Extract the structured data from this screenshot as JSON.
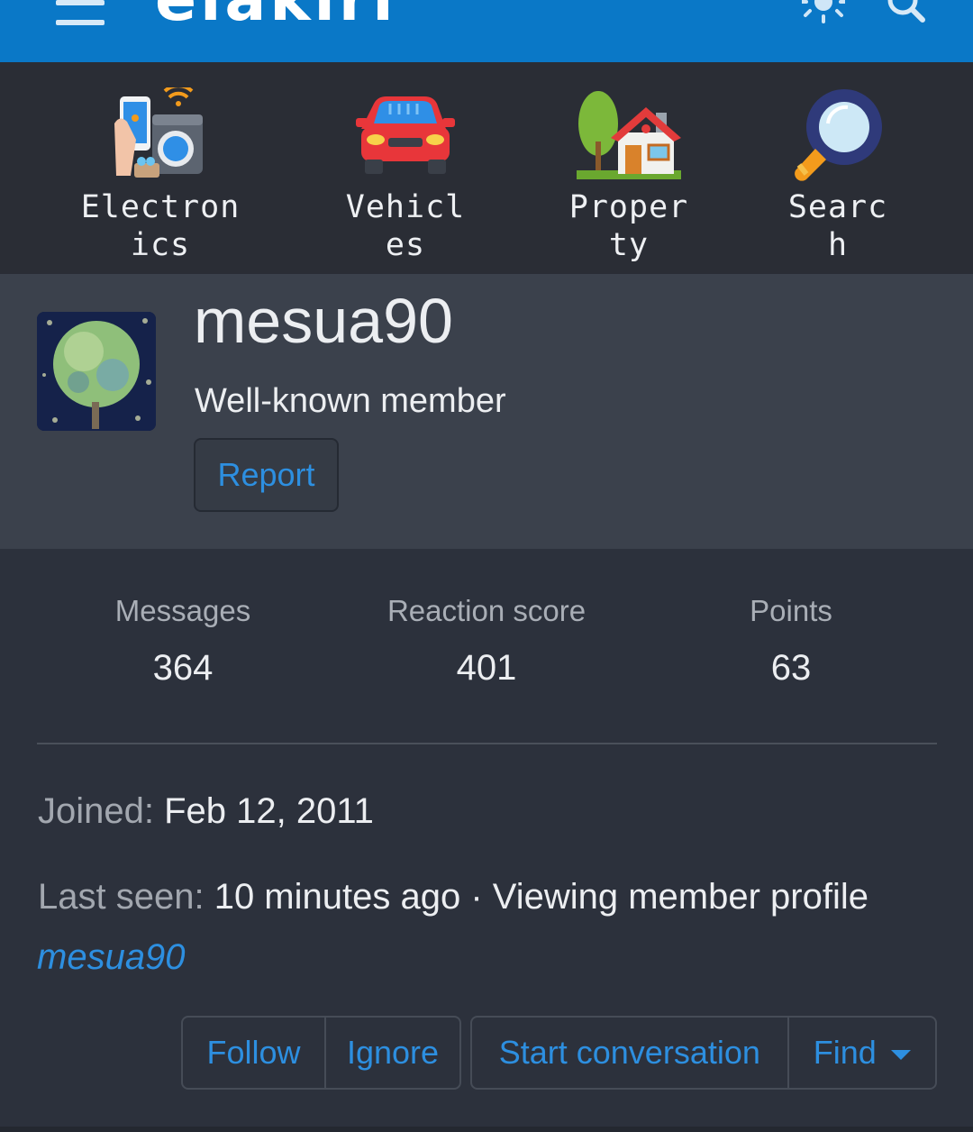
{
  "header": {
    "logo_text": "elakiri",
    "menu_icon": "hamburger-menu-icon",
    "theme_icon": "sun-icon",
    "search_icon": "search-icon",
    "brand_color": "#0a78c7"
  },
  "categories": [
    {
      "label": "Electron\nics",
      "icon": "electronics-icon"
    },
    {
      "label": "Vehicl\nes",
      "icon": "car-icon"
    },
    {
      "label": "Proper\nty",
      "icon": "house-icon"
    },
    {
      "label": "Searc\nh",
      "icon": "magnifier-icon"
    }
  ],
  "profile": {
    "username": "mesua90",
    "user_title": "Well-known member",
    "report_label": "Report",
    "avatar_icon": "tree-globe-avatar"
  },
  "stats": [
    {
      "label": "Messages",
      "value": "364"
    },
    {
      "label": "Reaction score",
      "value": "401"
    },
    {
      "label": "Points",
      "value": "63"
    }
  ],
  "info": {
    "joined_label": "Joined:",
    "joined_value": "Feb 12, 2011",
    "last_seen_label": "Last seen:",
    "last_seen_value": "10 minutes ago · Viewing member profile",
    "last_seen_link": "mesua90"
  },
  "actions": {
    "follow": "Follow",
    "ignore": "Ignore",
    "start_conversation": "Start conversation",
    "find": "Find"
  },
  "colors": {
    "link": "#2d8fe0",
    "background": "#2c313c",
    "profile_panel": "#3b414c"
  }
}
